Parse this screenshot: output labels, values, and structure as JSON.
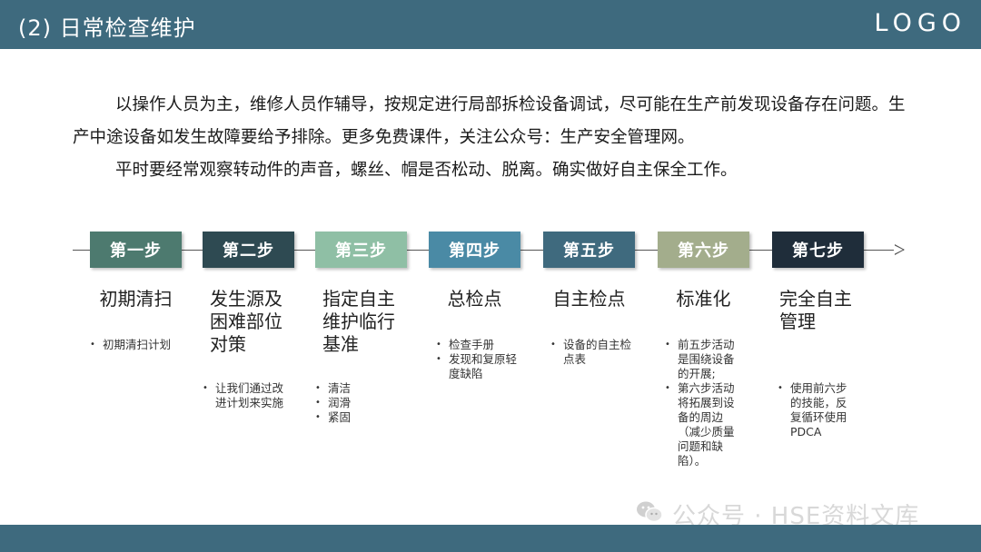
{
  "header": {
    "title": "(2)  日常检查维护",
    "logo": "LOGO"
  },
  "body": {
    "paragraph1": "以操作人员为主，维修人员作辅导，按规定进行局部拆检设备调试，尽可能在生产前发现设备存在问题。生产中途设备如发生故障要给予排除。更多免费课件，关注公众号：生产安全管理网。",
    "paragraph2": "平时要经常观察转动件的声音，螺丝、帽是否松动、脱离。确实做好自主保全工作。"
  },
  "steps": [
    {
      "label": "第一步",
      "color": "#4d7a6f",
      "heading": "初期清扫",
      "bullets": [
        "初期清扫计划"
      ]
    },
    {
      "label": "第二步",
      "color": "#2e4a52",
      "heading": "发生源及困难部位对策",
      "bullets": [
        "让我们通过改进计划来实施"
      ]
    },
    {
      "label": "第三步",
      "color": "#8fbfa5",
      "heading": "指定自主维护临行基准",
      "bullets": [
        "清洁",
        "润滑",
        "紧固"
      ]
    },
    {
      "label": "第四步",
      "color": "#4a8aa5",
      "heading": "总检点",
      "bullets": [
        "检查手册",
        "发现和复原轻度缺陷"
      ]
    },
    {
      "label": "第五步",
      "color": "#3f6a7e",
      "heading": "自主检点",
      "bullets": [
        "设备的自主检点表"
      ]
    },
    {
      "label": "第六步",
      "color": "#a3ad8c",
      "heading": "标准化",
      "bullets": [
        "前五步活动是围绕设备的开展;",
        "第六步活动将拓展到设备的周边",
        "（减少质量问题和缺陷）。"
      ]
    },
    {
      "label": "第七步",
      "color": "#1f2d3a",
      "heading": "完全自主管理",
      "bullets": [
        "使用前六步的技能，反复循环使用PDCA"
      ]
    }
  ],
  "watermark": "公众号 · HSE资料文库"
}
